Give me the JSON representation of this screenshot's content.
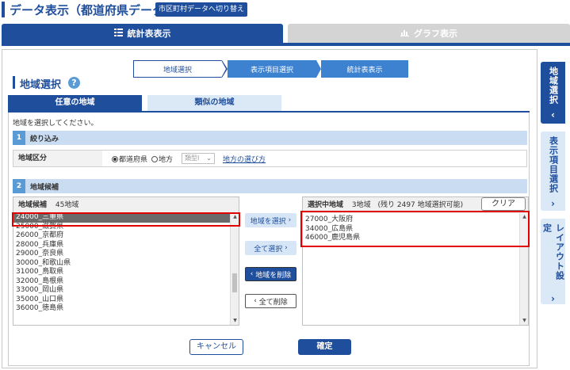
{
  "header": {
    "title": "データ表示（都道府県データ）",
    "switch_button": "市区町村データへ切り替え"
  },
  "main_tabs": [
    {
      "label": "統計表表示",
      "icon": "table-icon",
      "active": true
    },
    {
      "label": "グラフ表示",
      "icon": "bar-chart-icon",
      "active": false
    }
  ],
  "steps": [
    "地域選択",
    "表示項目選択",
    "統計表表示"
  ],
  "section": {
    "title": "地域選択",
    "help_icon": "question-icon"
  },
  "sub_tabs": [
    {
      "label": "任意の地域",
      "active": true
    },
    {
      "label": "類似の地域",
      "active": false
    }
  ],
  "instruction": "地域を選択してください。",
  "filter": {
    "heading_num": "1",
    "heading": "絞り込み",
    "label": "地域区分",
    "radio_prefecture": "都道府県",
    "radio_region": "地方",
    "type_select": "類型Ⅰ",
    "region_link": "地方の選び方"
  },
  "candidates": {
    "heading_num": "2",
    "heading": "地域候補",
    "panel_title": "地域候補",
    "count": "45地域",
    "items": [
      "24000_三重県",
      "25000_滋賀県",
      "26000_京都府",
      "28000_兵庫県",
      "29000_奈良県",
      "30000_和歌山県",
      "31000_鳥取県",
      "32000_島根県",
      "33000_岡山県",
      "35000_山口県",
      "36000_徳島県"
    ],
    "selected_index": 0
  },
  "selected": {
    "panel_title": "選択中地域",
    "count": "3地域",
    "remaining": "(残り 2497 地域選択可能)",
    "clear_button": "クリア",
    "items": [
      "27000_大阪府",
      "34000_広島県",
      "46000_鹿児島県"
    ]
  },
  "transfer_buttons": {
    "select": "地域を選択",
    "select_all": "全て選択",
    "remove": "地域を削除",
    "remove_all": "全て削除"
  },
  "footer": {
    "cancel": "キャンセル",
    "confirm": "確定"
  },
  "side_tabs": [
    {
      "label": "地域選択",
      "active": true
    },
    {
      "label": "表示項目選択",
      "active": false
    },
    {
      "label": "レイアウト設定",
      "active": false
    }
  ],
  "colors": {
    "primary": "#1f4e9c",
    "accent": "#3c82d0",
    "highlight": "#e00000"
  }
}
